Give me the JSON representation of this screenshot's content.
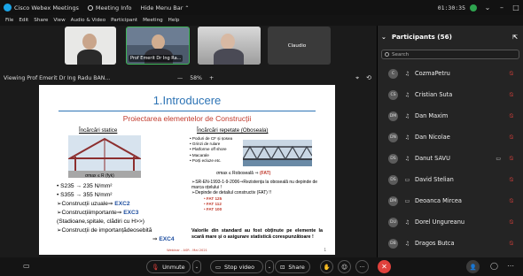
{
  "window": {
    "app_title": "Cisco Webex Meetings",
    "meeting_info": "Meeting Info",
    "hide_menu_bar": "Hide Menu Bar",
    "clock": "01:30:35",
    "minimize": "–",
    "maximize": "□",
    "accent_color": "#1aa5e8"
  },
  "menu": [
    "File",
    "Edit",
    "Share",
    "View",
    "Audio & Video",
    "Participant",
    "Meeting",
    "Help"
  ],
  "thumbnails": [
    {
      "name": ""
    },
    {
      "name": "Prof Emerit Dr Ing Ra..."
    },
    {
      "name": ""
    },
    {
      "name": "Claudio"
    }
  ],
  "view": {
    "label": "Viewing Prof Emerit Dr Ing Radu BAN...",
    "zoom_out": "—",
    "zoom_level": "58%",
    "zoom_in": "+"
  },
  "slide": {
    "title": "1.Introducere",
    "subtitle": "Proiectarea elementelor de Construcții",
    "static_heading": "Încărcări statice",
    "repeat_heading": "Încărcări repetate (Oboseala)",
    "static_formula": "σmax ≤ R (fyk)",
    "repeat_items": [
      "Poduri de CF și șosea",
      "Grinzi de rulare",
      "Platforme off shore",
      "Macarale",
      "Porți ecluze etc."
    ],
    "repeat_formula_text": "σmax ≤ Roboseală ⇒",
    "repeat_formula_fat": "(FAT)",
    "left_rows": [
      {
        "text": "• S235 → 235 N/mm²",
        "tag": ""
      },
      {
        "text": "• S355 → 355 N/mm²",
        "tag": ""
      },
      {
        "text": "➢Construcții uzuale⇒ ",
        "tag": "EXC2"
      },
      {
        "text": "➢Construcțiiimportante⇒ ",
        "tag": "EXC3"
      },
      {
        "text": "(Stadioane,spitale, clădiri cu H>>)",
        "tag": ""
      },
      {
        "text": "➢Construcții de importanțădeosebită",
        "tag": ""
      },
      {
        "text": "⇒ ",
        "tag": "EXC4"
      }
    ],
    "right_rows": [
      "➢SR-EN-1993-1-9-2006⇒Rezistența la oboseală nu depinde de marca oțelului !",
      "➢Depinde de detaliul constructiv (FAT) !!"
    ],
    "fat_values": [
      "• FAT 125",
      "• FAT 112",
      "• FAT 100"
    ],
    "conclusion": "Valorile din standard au fost obținute pe elemente la scară mare și o asigurare statistică corespunzătoare !",
    "footer": "Webinar - ASR - Mai 2021",
    "page": "1"
  },
  "participants": {
    "header": "Participants (56)",
    "search_placeholder": "Search",
    "list": [
      {
        "initials": "C",
        "name": "CozmaPetru",
        "device": "headset",
        "camera": ""
      },
      {
        "initials": "CS",
        "name": "Cristian Suta",
        "device": "headset",
        "camera": ""
      },
      {
        "initials": "DM",
        "name": "Dan Maxim",
        "device": "headset",
        "camera": ""
      },
      {
        "initials": "DN",
        "name": "Dan Nicolae",
        "device": "headset",
        "camera": ""
      },
      {
        "initials": "DS",
        "name": "Danut SAVU",
        "device": "headset",
        "camera": "video"
      },
      {
        "initials": "DS",
        "name": "David Stelian",
        "device": "desktop",
        "camera": ""
      },
      {
        "initials": "DM",
        "name": "Deoanca Mircea",
        "device": "desktop",
        "camera": ""
      },
      {
        "initials": "DU",
        "name": "Dorel Ungureanu",
        "device": "headset",
        "camera": ""
      },
      {
        "initials": "DB",
        "name": "Dragos Butca",
        "device": "headset",
        "camera": ""
      }
    ],
    "muted_color": "#e0413c"
  },
  "controls": {
    "unmute": "Unmute",
    "stop_video": "Stop video",
    "share": "Share",
    "leave_color": "#e0413c"
  }
}
